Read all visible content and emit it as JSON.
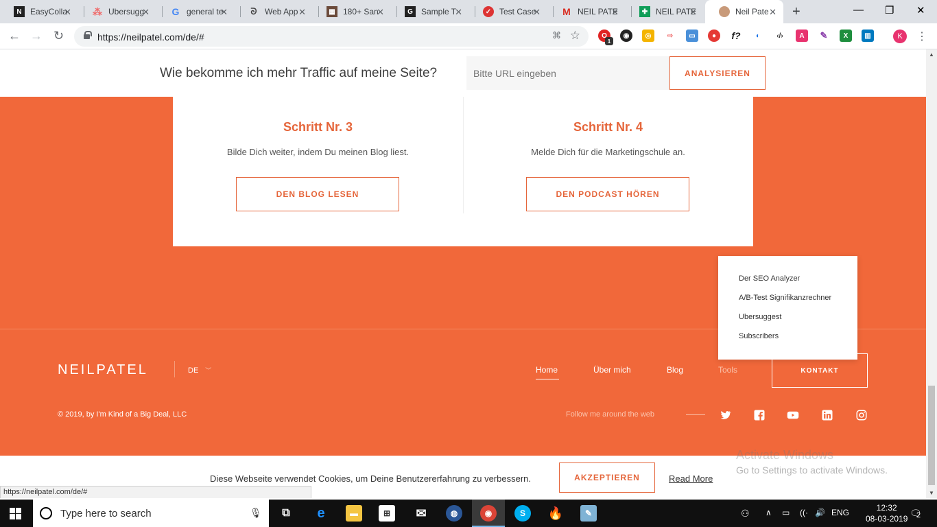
{
  "browser": {
    "tabs": [
      {
        "title": "EasyColla",
        "icon": "notion-icon",
        "active": false
      },
      {
        "title": "Ubersugg",
        "icon": "asana-icon",
        "active": false
      },
      {
        "title": "general te",
        "icon": "google-icon",
        "active": false
      },
      {
        "title": "Web App",
        "icon": "web-app-icon",
        "active": false
      },
      {
        "title": "180+ San",
        "icon": "sample-icon",
        "active": false
      },
      {
        "title": "Sample T",
        "icon": "g-icon",
        "active": false
      },
      {
        "title": "Test Case",
        "icon": "testcase-icon",
        "active": false
      },
      {
        "title": "NEIL PATE",
        "icon": "gmail-icon",
        "active": false
      },
      {
        "title": "NEIL PATE",
        "icon": "sheets-icon",
        "active": false
      },
      {
        "title": "Neil Pate",
        "icon": "neil-avatar-icon",
        "active": true
      }
    ],
    "url": "https://neilpatel.com/de/#",
    "profile_initial": "K",
    "extension_badge": "1"
  },
  "page": {
    "topbar": {
      "question": "Wie bekomme ich mehr Traffic auf meine Seite?",
      "url_placeholder": "Bitte URL eingeben",
      "analyze_label": "ANALYSIEREN"
    },
    "steps": [
      {
        "heading": "Schritt Nr. 3",
        "text": "Bilde Dich weiter, indem Du meinen Blog liest.",
        "button": "DEN BLOG LESEN"
      },
      {
        "heading": "Schritt Nr. 4",
        "text": "Melde Dich für die Marketingschule an.",
        "button": "DEN PODCAST HÖREN"
      }
    ],
    "tools_dropdown": [
      "Der SEO Analyzer",
      "A/B-Test Signifikanzrechner",
      "Ubersuggest",
      "Subscribers"
    ],
    "footer": {
      "logo": "NEILPATEL",
      "language": "DE",
      "nav": [
        "Home",
        "Über mich",
        "Blog",
        "Tools"
      ],
      "contact_label": "KONTAKT",
      "copyright": "© 2019, by I'm Kind of a Big Deal, LLC",
      "follow_label": "Follow me around the web",
      "social": [
        "twitter-icon",
        "facebook-icon",
        "youtube-icon",
        "linkedin-icon",
        "instagram-icon"
      ]
    },
    "cookie": {
      "message": "Diese Webseite verwendet Cookies, um Deine Benutzererfahrung zu verbessern.",
      "accept_label": "AKZEPTIEREN",
      "read_more": "Read More"
    },
    "status_url": "https://neilpatel.com/de/#",
    "watermark": {
      "title": "Activate Windows",
      "subtitle": "Go to Settings to activate Windows."
    }
  },
  "taskbar": {
    "search_placeholder": "Type here to search",
    "language": "ENG",
    "time": "12:32",
    "date": "08-03-2019",
    "notification_count": "2"
  },
  "colors": {
    "brand_orange": "#f1683a",
    "button_orange": "#e5653a"
  }
}
